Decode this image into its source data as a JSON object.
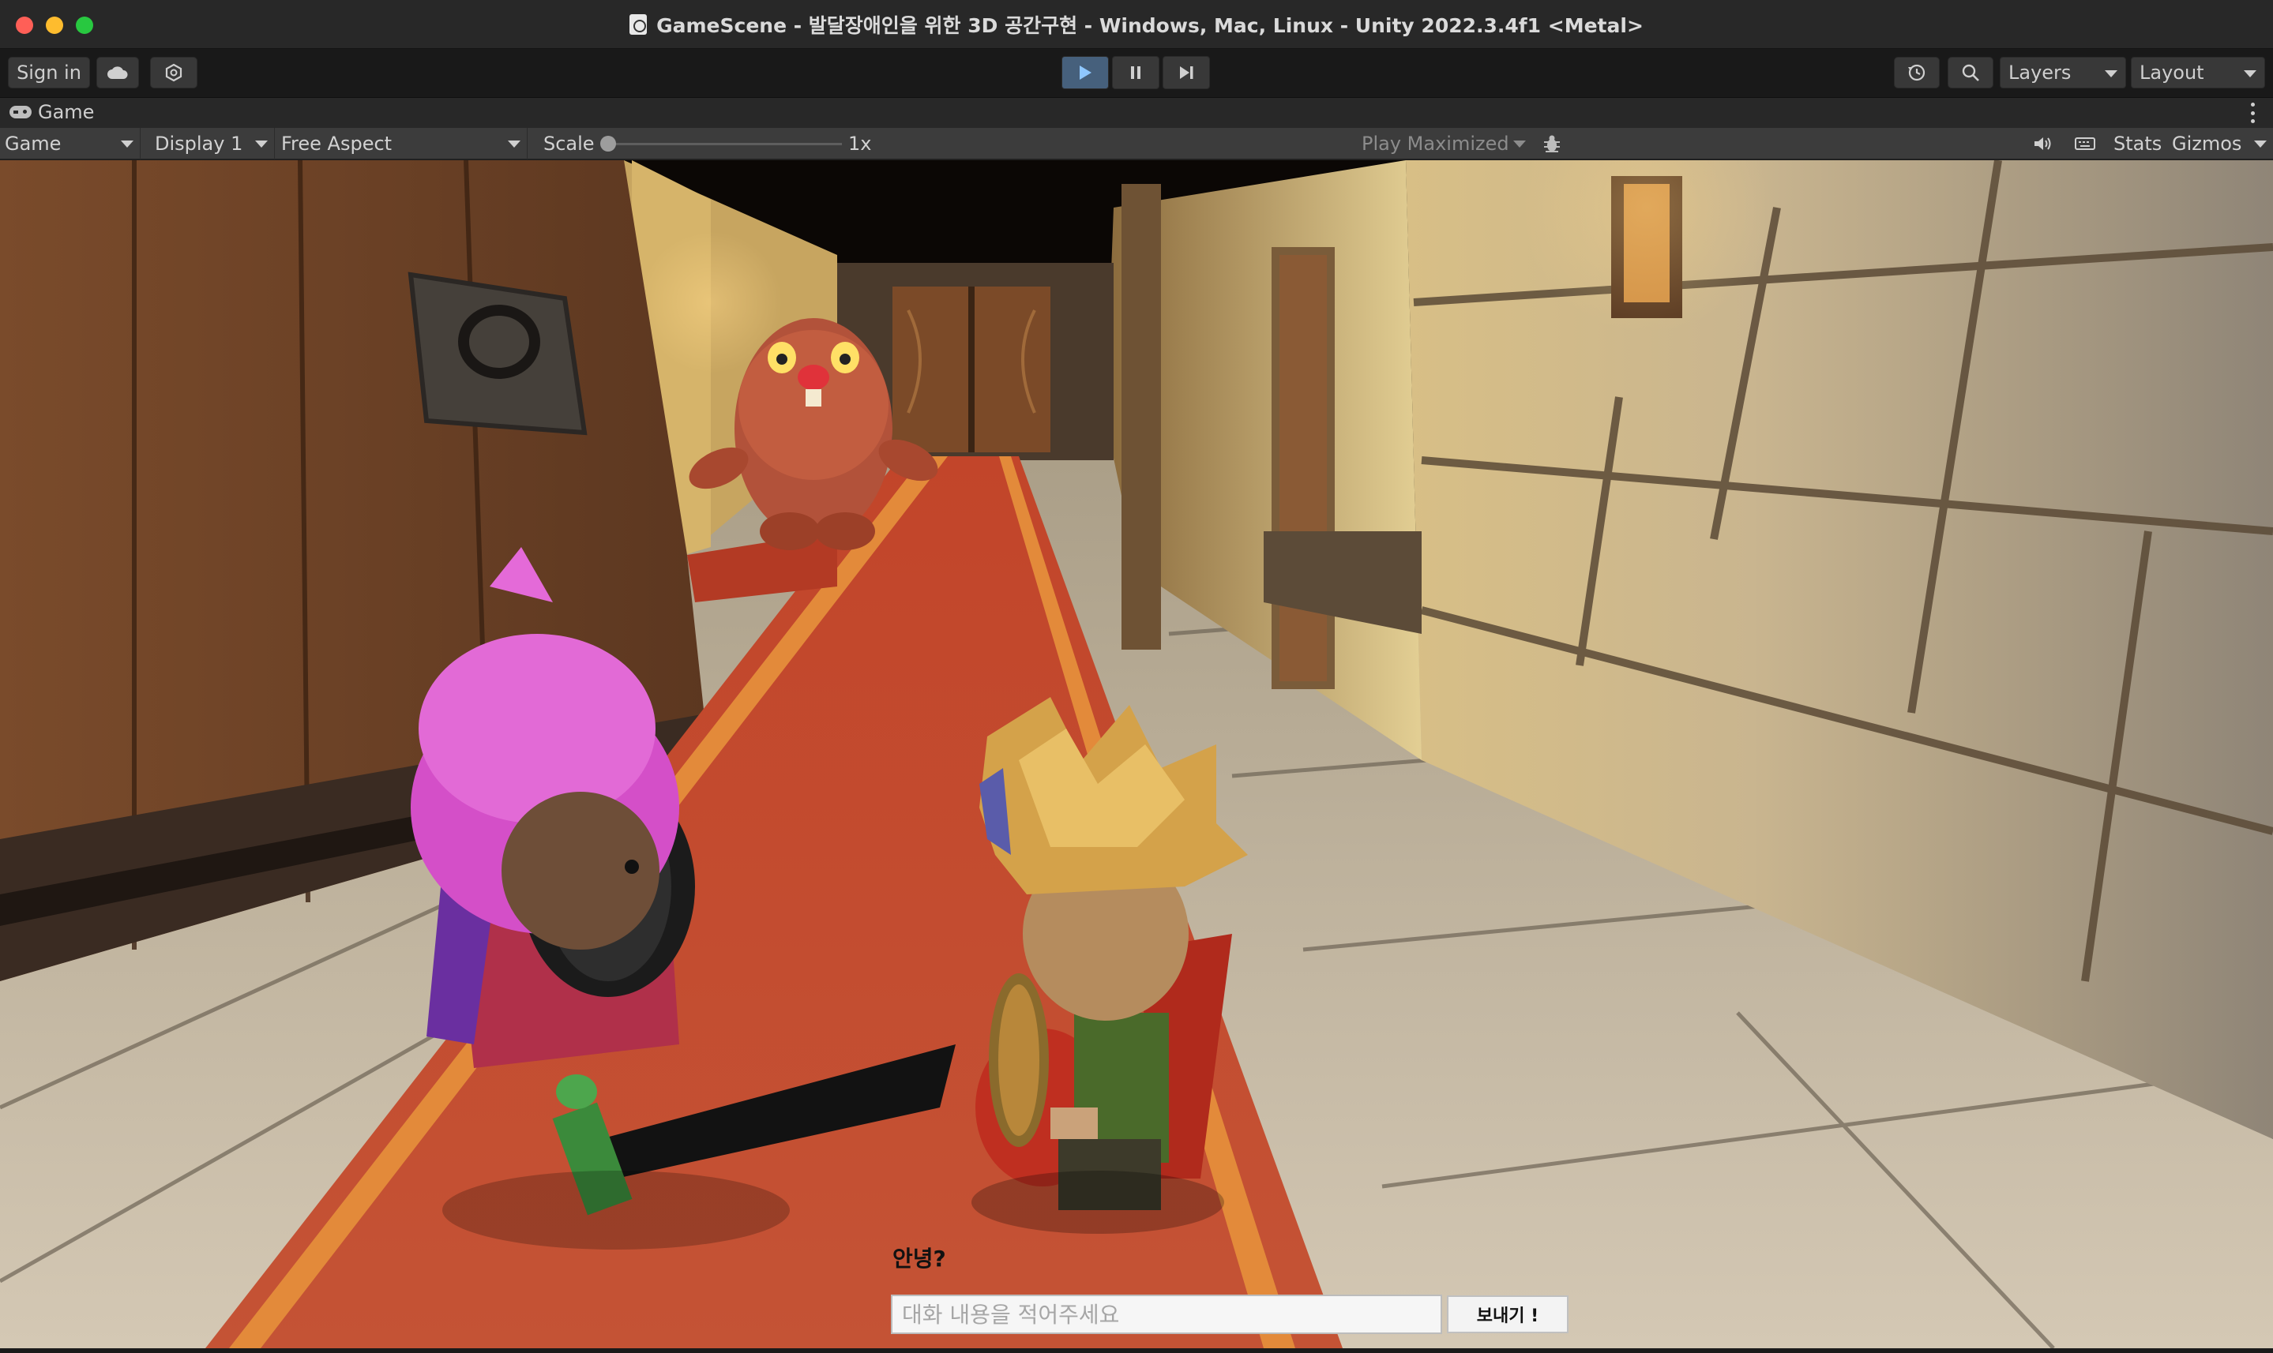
{
  "window": {
    "title": "GameScene - 발달장애인을 위한 3D 공간구현 - Windows, Mac, Linux - Unity 2022.3.4f1 <Metal>"
  },
  "toolbar": {
    "sign_in_label": "Sign in",
    "cloud_icon": "cloud-icon",
    "collab_icon": "collab-icon",
    "play_icon": "play-icon",
    "pause_icon": "pause-icon",
    "step_icon": "step-icon",
    "play_active_color": "#46607c",
    "history_icon": "history-icon",
    "search_icon": "search-icon",
    "layers_label": "Layers",
    "layout_label": "Layout"
  },
  "game_tab": {
    "label": "Game"
  },
  "game_bar": {
    "view_select": "Game",
    "display_select": "Display 1",
    "aspect_select": "Free Aspect",
    "scale_label": "Scale",
    "scale_value": "1x",
    "play_maximized": "Play Maximized",
    "stats_label": "Stats",
    "gizmos_label": "Gizmos"
  },
  "chat": {
    "message": "안녕?",
    "placeholder": "대화 내용을 적어주세요",
    "send_label": "보내기 !"
  }
}
